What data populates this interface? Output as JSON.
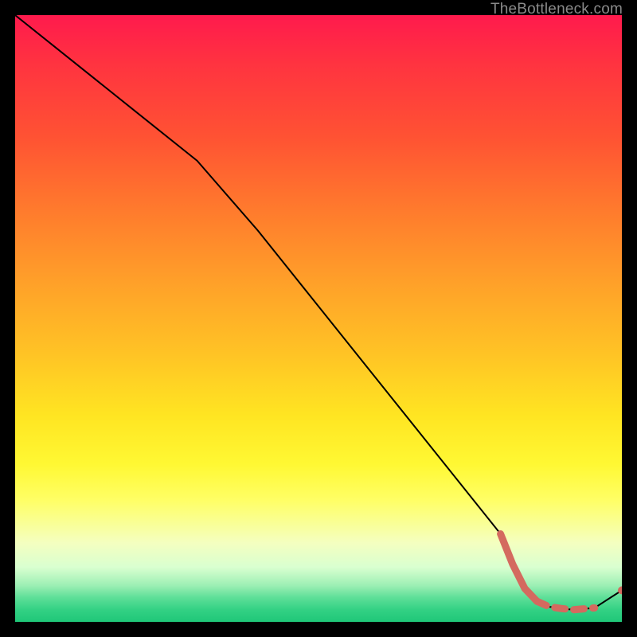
{
  "watermark": "TheBottleneck.com",
  "chart_data": {
    "type": "line",
    "title": "",
    "xlabel": "",
    "ylabel": "",
    "xlim": [
      0,
      100
    ],
    "ylim": [
      0,
      100
    ],
    "series": [
      {
        "name": "curve-main",
        "style": "solid-thin-black",
        "x": [
          0,
          10,
          20,
          30,
          40,
          50,
          60,
          70,
          80,
          82,
          84,
          86,
          88,
          90,
          92,
          95.5,
          100
        ],
        "y": [
          100,
          92,
          84,
          76,
          64.5,
          52,
          39.5,
          27,
          14.5,
          9.5,
          5.5,
          3.4,
          2.5,
          2.2,
          2.0,
          2.3,
          5.2
        ]
      },
      {
        "name": "curve-highlight-solid",
        "style": "solid-thick-salmon",
        "x": [
          80,
          82,
          84,
          86
        ],
        "y": [
          14.5,
          9.5,
          5.5,
          3.4
        ]
      },
      {
        "name": "curve-highlight-dashed",
        "style": "dashed-thick-salmon",
        "x": [
          86,
          88,
          90,
          92,
          95.5
        ],
        "y": [
          3.4,
          2.5,
          2.2,
          2.0,
          2.3
        ]
      },
      {
        "name": "end-dot",
        "style": "dot-salmon",
        "x": [
          100
        ],
        "y": [
          5.2
        ]
      }
    ],
    "colors": {
      "black": "#000000",
      "salmon": "#d46a5f"
    }
  }
}
